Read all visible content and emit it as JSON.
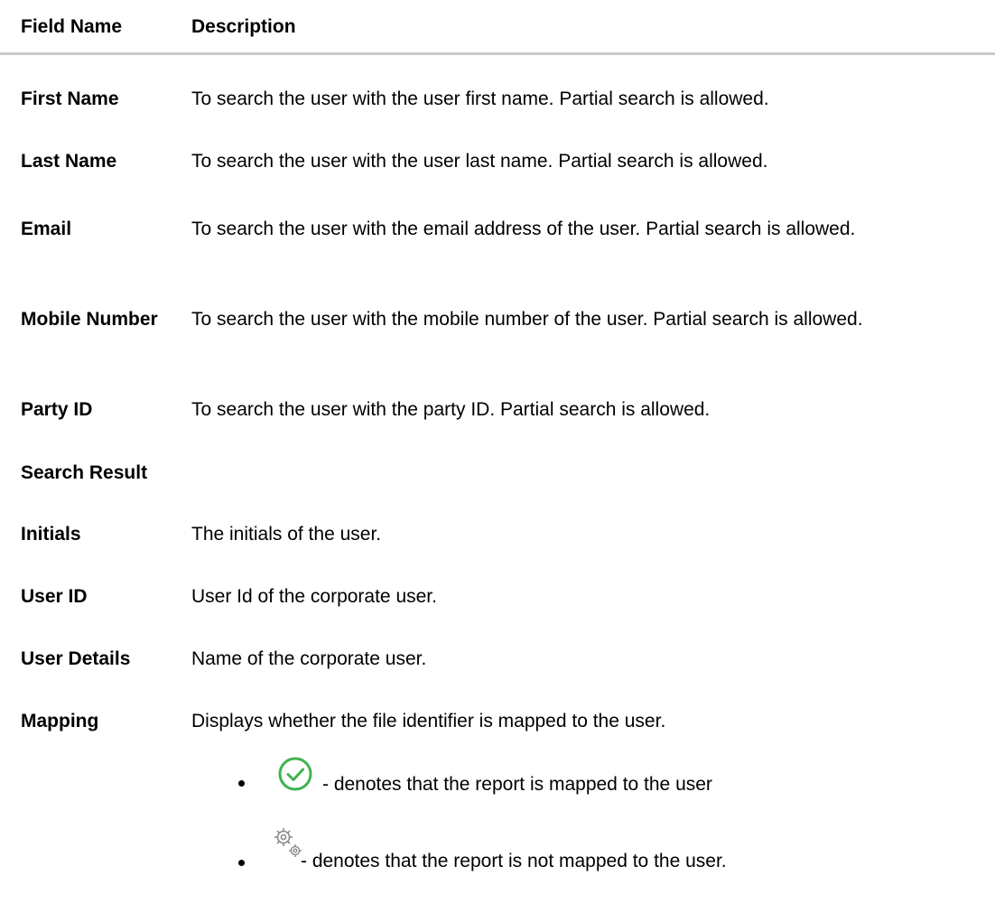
{
  "header": {
    "field_name": "Field Name",
    "description": "Description"
  },
  "fields": [
    {
      "name": "First Name",
      "description": "To search the user with the user first name. Partial search is allowed."
    },
    {
      "name": "Last Name",
      "description": "To search the user with the user last name. Partial search is allowed."
    },
    {
      "name": "Email",
      "description": "To search the user with the email address of the user. Partial search is allowed."
    },
    {
      "name": "Mobile Number",
      "description": "To search the user with the mobile number of the user. Partial search is allowed."
    },
    {
      "name": "Party ID",
      "description": "To search the user with the party ID. Partial search is allowed."
    }
  ],
  "section_title": "Search Result",
  "result_fields": [
    {
      "name": "Initials",
      "description": "The initials of the user."
    },
    {
      "name": "User ID",
      "description": "User Id of the corporate user."
    },
    {
      "name": "User Details",
      "description": "Name of the corporate user."
    },
    {
      "name": "Mapping",
      "description": "Displays whether the file identifier is mapped to the user."
    }
  ],
  "mapping_bullets": [
    {
      "icon": "check-circle-icon",
      "text": "- denotes that the report is mapped to the user"
    },
    {
      "icon": "gears-icon",
      "text": "- denotes that the report is not mapped to the user."
    }
  ],
  "colors": {
    "check_green": "#3fb24f",
    "gear_gray": "#8a8a8a",
    "rule_gray": "#c9c9c9"
  }
}
